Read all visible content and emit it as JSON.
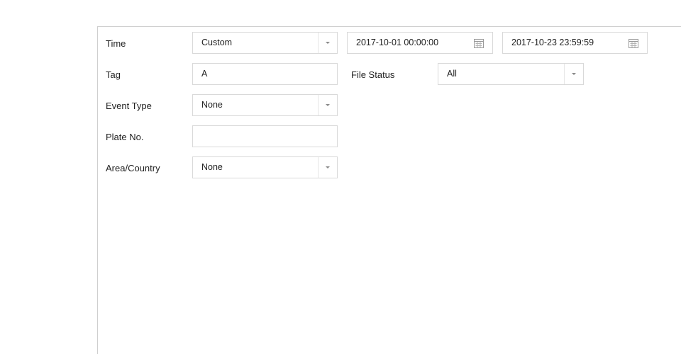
{
  "form": {
    "time": {
      "label": "Time",
      "mode": "Custom",
      "start": "2017-10-01 00:00:00",
      "end": "2017-10-23 23:59:59"
    },
    "tag": {
      "label": "Tag",
      "value": "A"
    },
    "file_status": {
      "label": "File Status",
      "value": "All"
    },
    "event_type": {
      "label": "Event Type",
      "value": "None"
    },
    "plate_no": {
      "label": "Plate No.",
      "value": ""
    },
    "area_country": {
      "label": "Area/Country",
      "value": "None"
    }
  },
  "icons": {
    "dropdown": "chevron-down-icon",
    "date_picker": "calendar-icon"
  },
  "colors": {
    "border": "#d9d9d9",
    "text": "#222222",
    "caret": "#8a8a8a"
  }
}
